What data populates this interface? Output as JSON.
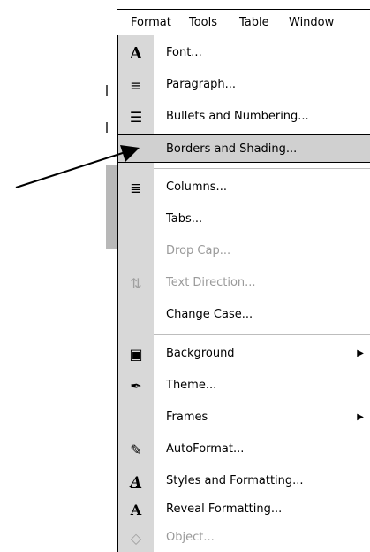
{
  "menubar": {
    "items": [
      {
        "label": "Format",
        "active": true
      },
      {
        "label": "Tools"
      },
      {
        "label": "Table"
      },
      {
        "label": "Window"
      }
    ]
  },
  "menu": {
    "items": [
      {
        "label": "Font...",
        "icon": "font-icon",
        "glyph": "A"
      },
      {
        "label": "Paragraph...",
        "icon": "paragraph-icon",
        "glyph": "≡"
      },
      {
        "label": "Bullets and Numbering...",
        "icon": "bullets-icon",
        "glyph": "☰"
      },
      {
        "label": "Borders and Shading...",
        "icon": "",
        "glyph": "",
        "highlighted": true
      },
      {
        "label": "Columns...",
        "icon": "columns-icon",
        "glyph": "≣"
      },
      {
        "label": "Tabs...",
        "icon": "",
        "glyph": ""
      },
      {
        "label": "Drop Cap...",
        "icon": "",
        "glyph": "",
        "disabled": true
      },
      {
        "label": "Text Direction...",
        "icon": "text-direction-icon",
        "glyph": "⇅",
        "disabled": true
      },
      {
        "label": "Change Case...",
        "icon": "",
        "glyph": ""
      },
      {
        "label": "Background",
        "icon": "background-icon",
        "glyph": "▣",
        "submenu": true
      },
      {
        "label": "Theme...",
        "icon": "theme-icon",
        "glyph": "✒"
      },
      {
        "label": "Frames",
        "icon": "",
        "glyph": "",
        "submenu": true
      },
      {
        "label": "AutoFormat...",
        "icon": "autoformat-icon",
        "glyph": "✎"
      },
      {
        "label": "Styles and Formatting...",
        "icon": "styles-icon",
        "glyph": "A"
      },
      {
        "label": "Reveal Formatting...",
        "icon": "reveal-formatting-icon",
        "glyph": "A"
      },
      {
        "label": "Object...",
        "icon": "object-icon",
        "glyph": "◇",
        "disabled": true
      }
    ],
    "submenu_arrow": "▶"
  },
  "colors": {
    "gutter": "#d8d8d8",
    "highlight": "#d0d0d0",
    "disabled_text": "#9a9a9a"
  }
}
